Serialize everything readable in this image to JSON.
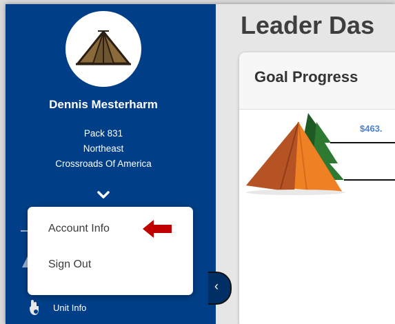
{
  "user": {
    "name": "Dennis Mesterharm",
    "pack": "Pack 831",
    "district": "Northeast",
    "council": "Crossroads Of America"
  },
  "account_menu": {
    "items": [
      {
        "label": "Account Info"
      },
      {
        "label": "Sign Out"
      }
    ]
  },
  "sidebar": {
    "unit_info_label": "Unit Info",
    "unit_info_icon": "hand-icon"
  },
  "main": {
    "page_title": "Leader Das",
    "card_title": "Goal Progress",
    "goal_amount": "$463."
  },
  "colors": {
    "sidebar_bg": "#003f87",
    "arrow": "#c00000",
    "money": "#4a7fd0"
  }
}
